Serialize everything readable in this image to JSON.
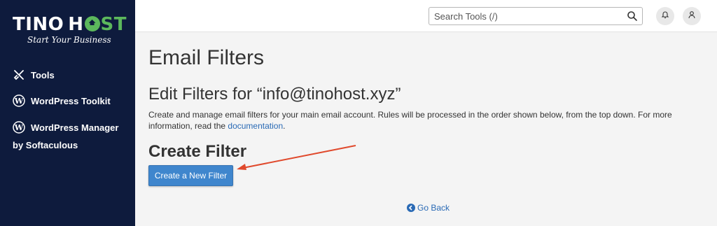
{
  "brand": {
    "name_part1": "TINO",
    "name_part2": "H",
    "name_part3": "ST",
    "tagline": "Start Your Business",
    "accent_color": "#5cb85c",
    "sidebar_bg": "#0e1b3d"
  },
  "sidebar": {
    "items": [
      {
        "label": "Tools",
        "icon": "tools-icon"
      },
      {
        "label": "WordPress Toolkit",
        "icon": "wordpress-icon"
      },
      {
        "label": "WordPress Manager",
        "icon": "wordpress-icon",
        "sub": "by Softaculous"
      }
    ]
  },
  "header": {
    "search_placeholder": "Search Tools (/)",
    "search_icon": "search-icon",
    "notifications_icon": "bell-icon",
    "user_icon": "user-icon"
  },
  "main": {
    "page_title": "Email Filters",
    "subtitle": "Edit Filters for “info@tinohost.xyz”",
    "description": "Create and manage email filters for your main email account. Rules will be processed in the order shown below, from the top down. For more information, read the ",
    "description_link": "documentation",
    "description_end": ".",
    "section_title": "Create Filter",
    "create_button": "Create a New Filter",
    "go_back": "Go Back",
    "button_color": "#3f86cd",
    "annotation_arrow_color": "#e0492c"
  }
}
